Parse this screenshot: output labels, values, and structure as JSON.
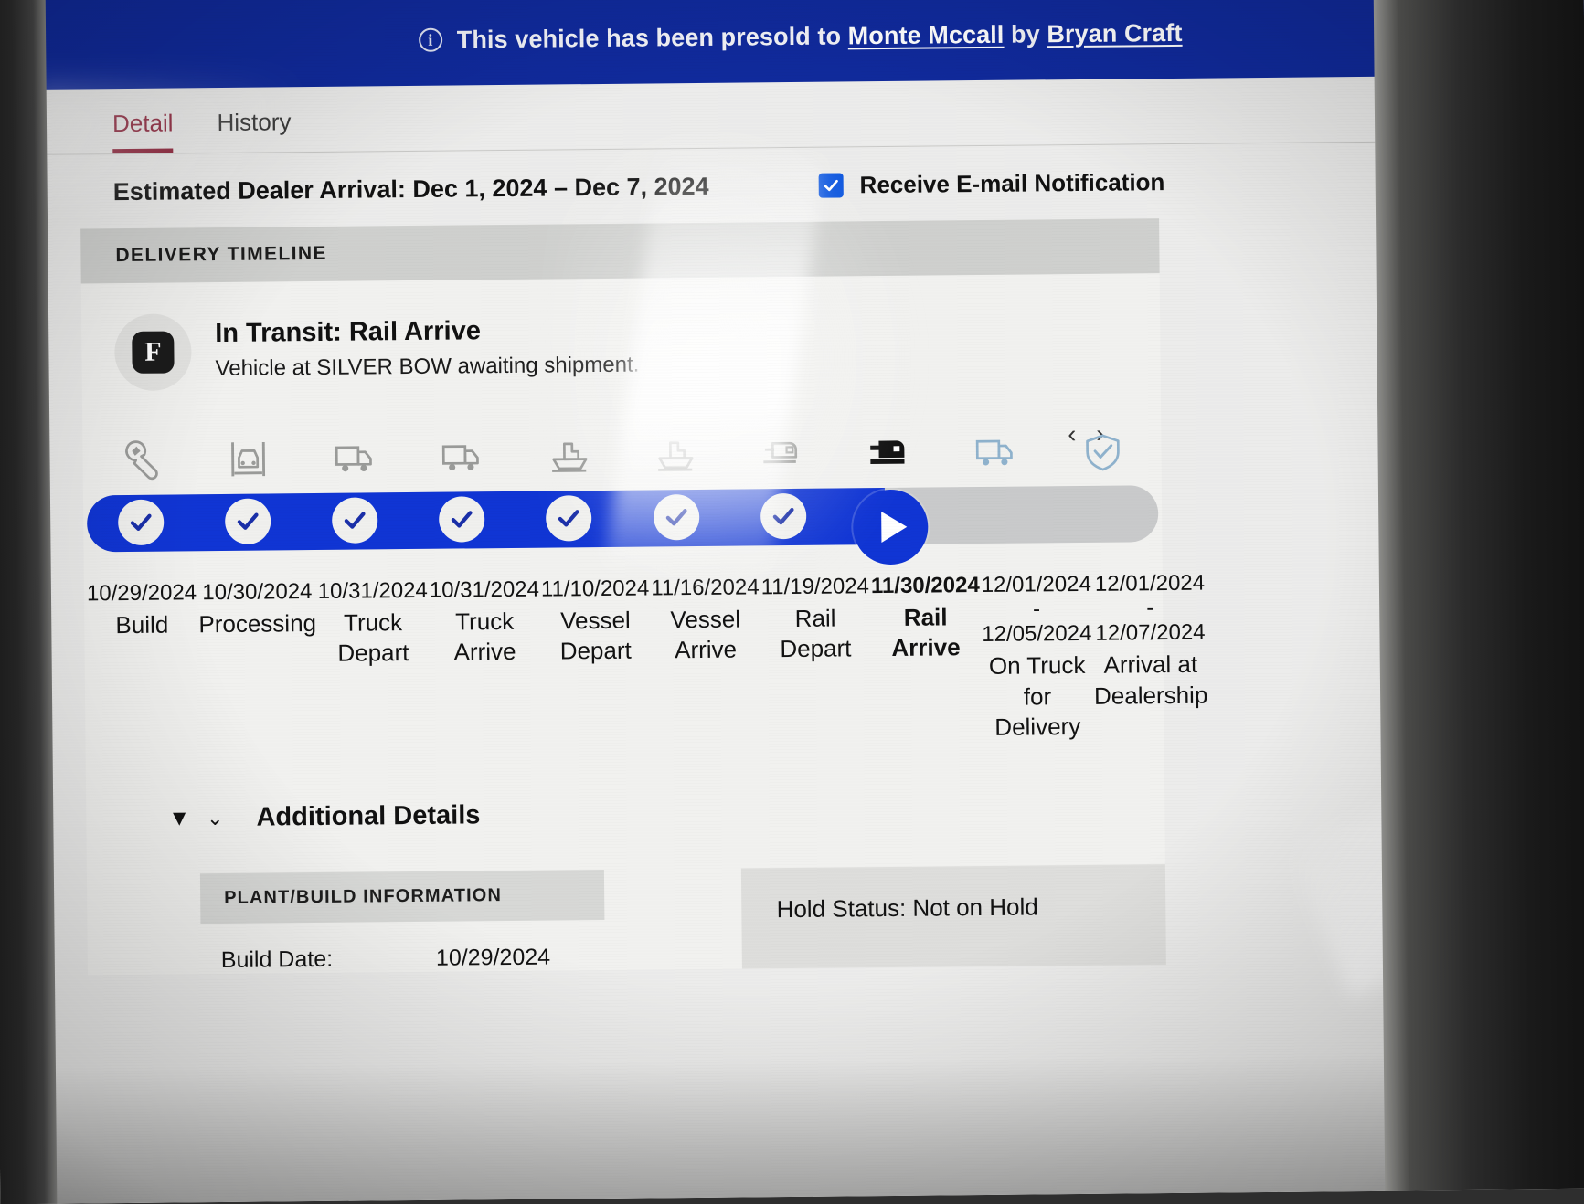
{
  "banner": {
    "icon": "info-circle-icon",
    "text_before": "This vehicle has been presold to",
    "buyer": "Monte Mccall",
    "by_word": "by",
    "seller": "Bryan Craft",
    "bg_color": "#102a9c"
  },
  "tabs": [
    {
      "label": "Detail",
      "active": true
    },
    {
      "label": "History",
      "active": false
    }
  ],
  "header": {
    "eta_label": "Estimated Dealer Arrival: Dec 1, 2024 – Dec 7, 2024",
    "notify_label": "Receive E-mail Notification",
    "notify_checked": true,
    "accent_color": "#8a1b33",
    "checkbox_color": "#1059e0"
  },
  "timeline_card": {
    "section_title": "DELIVERY TIMELINE",
    "brand_mark": "F",
    "status_lead": "In Transit:",
    "status_stage": "Rail Arrive",
    "status_detail": "Vehicle at SILVER BOW awaiting shipment.",
    "prev_arrow": "‹",
    "next_arrow": "›",
    "progress_color": "#1035d4",
    "track_color": "#c9cacb",
    "progress_percent": 74
  },
  "chart_data": {
    "type": "timeline",
    "title": "Delivery Timeline",
    "current_index": 7,
    "steps": [
      {
        "icon": "wrench-icon",
        "date": "10/29/2024",
        "date2": "",
        "name": "Build",
        "state": "done"
      },
      {
        "icon": "car-lift-icon",
        "date": "10/30/2024",
        "date2": "",
        "name": "Processing",
        "state": "done"
      },
      {
        "icon": "truck-icon",
        "date": "10/31/2024",
        "date2": "",
        "name": "Truck Depart",
        "state": "done"
      },
      {
        "icon": "truck-icon",
        "date": "10/31/2024",
        "date2": "",
        "name": "Truck Arrive",
        "state": "done"
      },
      {
        "icon": "ship-icon",
        "date": "11/10/2024",
        "date2": "",
        "name": "Vessel Depart",
        "state": "done"
      },
      {
        "icon": "ship-icon",
        "date": "11/16/2024",
        "date2": "",
        "name": "Vessel Arrive",
        "state": "done"
      },
      {
        "icon": "train-icon",
        "date": "11/19/2024",
        "date2": "",
        "name": "Rail Depart",
        "state": "done"
      },
      {
        "icon": "train-filled-icon",
        "date": "11/30/2024",
        "date2": "",
        "name": "Rail Arrive",
        "state": "current"
      },
      {
        "icon": "delivery-truck-icon",
        "date": "12/01/2024",
        "date2": "12/05/2024",
        "name": "On Truck for Delivery",
        "state": "upcoming"
      },
      {
        "icon": "shield-check-icon",
        "date": "12/01/2024",
        "date2": "12/07/2024",
        "name": "Arrival at Dealership",
        "state": "upcoming"
      }
    ]
  },
  "additional_details": {
    "caret_solid": "▼",
    "caret_thin": "⌄",
    "title": "Additional Details",
    "plant_panel": {
      "header": "PLANT/BUILD INFORMATION",
      "rows": [
        {
          "label": "Build Date:",
          "value": "10/29/2024"
        }
      ]
    },
    "hold_status": "Hold Status: Not on Hold"
  }
}
